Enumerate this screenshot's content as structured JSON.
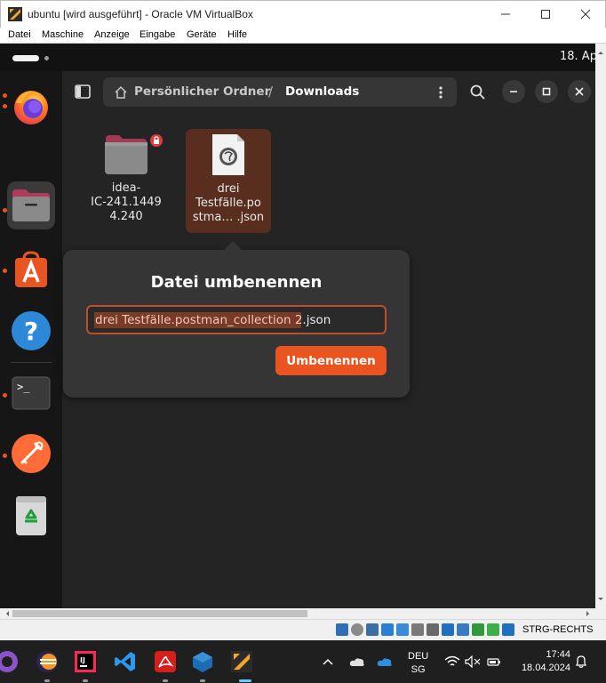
{
  "window": {
    "title": "ubuntu [wird ausgeführt] - Oracle VM VirtualBox"
  },
  "menu": [
    "Datei",
    "Maschine",
    "Anzeige",
    "Eingabe",
    "Geräte",
    "Hilfe"
  ],
  "guest_topbar": {
    "clock": "18. Ap"
  },
  "dock": [
    "firefox-icon",
    "files-icon",
    "app-center-icon",
    "help-icon",
    "terminal-icon",
    "postman-icon",
    "trash-icon"
  ],
  "files": {
    "breadcrumb": {
      "home": "Persönlicher Ordner",
      "separator": "/",
      "current": "Downloads"
    },
    "items": [
      {
        "name": "idea-IC-241.14494.240",
        "line1": "idea-",
        "line2": "IC-241.1449",
        "line3": "4.240",
        "type": "folder",
        "locked": true
      },
      {
        "name": "drei Testfälle.postman_collection.json",
        "line1": "drei",
        "line2": "Testfälle.po",
        "line3": "stma…  .json",
        "type": "json",
        "selected": true
      }
    ]
  },
  "rename_dialog": {
    "title": "Datei umbenennen",
    "value_selected": "drei Testfälle.postman_collection 2",
    "value_rest": ".json",
    "button": "Umbenennen"
  },
  "statusbar": {
    "host_key": "STRG-RECHTS"
  },
  "taskbar": {
    "apps": [
      "github-desktop-icon",
      "eclipse-icon",
      "intellij-icon",
      "vscode-icon",
      "acrobat-icon",
      "virtualbox-icon",
      "virtualbox-vm-icon"
    ],
    "language": "DEU",
    "layout": "SG",
    "time": "17:44",
    "date": "18.04.2024"
  },
  "colors": {
    "accent": "#e95420",
    "selection": "#5a2e1f"
  }
}
